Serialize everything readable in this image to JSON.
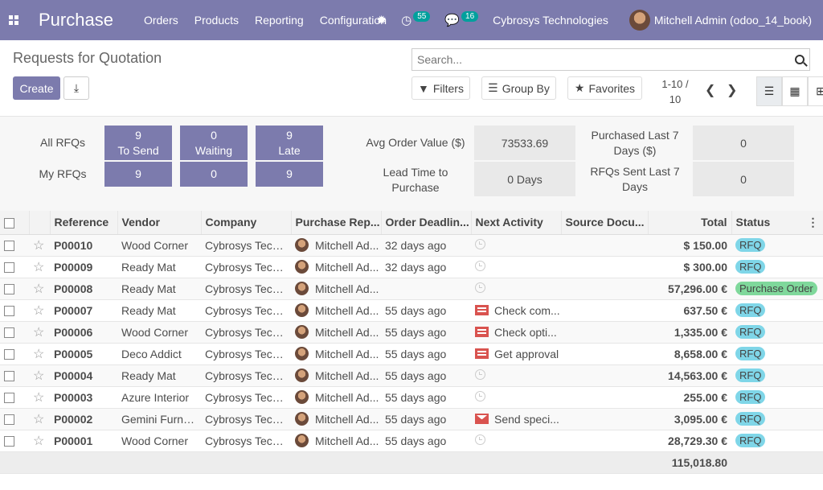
{
  "navbar": {
    "brand": "Purchase",
    "menu": [
      "Orders",
      "Products",
      "Reporting",
      "Configuration"
    ],
    "activity_count": "55",
    "message_count": "16",
    "company": "Cybrosys Technologies",
    "user": "Mitchell Admin (odoo_14_book)",
    "bg_color": "#7c7bad"
  },
  "control": {
    "breadcrumb": "Requests for Quotation",
    "create_label": "Create",
    "search_placeholder": "Search...",
    "filters_label": "Filters",
    "groupby_label": "Group By",
    "favorites_label": "Favorites",
    "pager_range": "1-10 /",
    "pager_total": "10"
  },
  "dashboard": {
    "all_rfqs_label": "All RFQs",
    "my_rfqs_label": "My RFQs",
    "to_send_count": "9",
    "to_send_label": "To Send",
    "waiting_count": "0",
    "waiting_label": "Waiting",
    "late_count": "9",
    "late_label": "Late",
    "my_to_send": "9",
    "my_waiting": "0",
    "my_late": "9",
    "avg_order_label": "Avg Order Value ($)",
    "avg_order_value": "73533.69",
    "lead_time_label": "Lead Time to Purchase",
    "lead_time_value": "0  Days",
    "purchased_label": "Purchased Last 7 Days ($)",
    "purchased_value": "0",
    "rfq_sent_label": "RFQs Sent Last 7 Days",
    "rfq_sent_value": "0"
  },
  "table": {
    "headers": [
      "Reference",
      "Vendor",
      "Company",
      "Purchase Rep...",
      "Order Deadlin...",
      "Next Activity",
      "Source Docu...",
      "Total",
      "Status"
    ],
    "rows": [
      {
        "ref": "P00010",
        "vendor": "Wood Corner",
        "company": "Cybrosys Tech...",
        "rep": "Mitchell Ad...",
        "deadline": "32 days ago",
        "activity": "",
        "activity_icon": "clock",
        "total": "$ 150.00",
        "status": "RFQ",
        "status_color": "#7fd6e8"
      },
      {
        "ref": "P00009",
        "vendor": "Ready Mat",
        "company": "Cybrosys Tech...",
        "rep": "Mitchell Ad...",
        "deadline": "32 days ago",
        "activity": "",
        "activity_icon": "clock",
        "total": "$ 300.00",
        "status": "RFQ",
        "status_color": "#7fd6e8"
      },
      {
        "ref": "P00008",
        "vendor": "Ready Mat",
        "company": "Cybrosys Tech...",
        "rep": "Mitchell Ad...",
        "deadline": "",
        "activity": "",
        "activity_icon": "clock",
        "total": "57,296.00 €",
        "status": "Purchase Order",
        "status_color": "#7fd89b"
      },
      {
        "ref": "P00007",
        "vendor": "Ready Mat",
        "company": "Cybrosys Tech...",
        "rep": "Mitchell Ad...",
        "deadline": "55 days ago",
        "activity": "Check com...",
        "activity_icon": "todo",
        "total": "637.50 €",
        "status": "RFQ",
        "status_color": "#7fd6e8"
      },
      {
        "ref": "P00006",
        "vendor": "Wood Corner",
        "company": "Cybrosys Tech...",
        "rep": "Mitchell Ad...",
        "deadline": "55 days ago",
        "activity": "Check opti...",
        "activity_icon": "todo",
        "total": "1,335.00 €",
        "status": "RFQ",
        "status_color": "#7fd6e8"
      },
      {
        "ref": "P00005",
        "vendor": "Deco Addict",
        "company": "Cybrosys Tech...",
        "rep": "Mitchell Ad...",
        "deadline": "55 days ago",
        "activity": "Get approval",
        "activity_icon": "todo",
        "total": "8,658.00 €",
        "status": "RFQ",
        "status_color": "#7fd6e8"
      },
      {
        "ref": "P00004",
        "vendor": "Ready Mat",
        "company": "Cybrosys Tech...",
        "rep": "Mitchell Ad...",
        "deadline": "55 days ago",
        "activity": "",
        "activity_icon": "clock",
        "total": "14,563.00 €",
        "status": "RFQ",
        "status_color": "#7fd6e8"
      },
      {
        "ref": "P00003",
        "vendor": "Azure Interior",
        "company": "Cybrosys Tech...",
        "rep": "Mitchell Ad...",
        "deadline": "55 days ago",
        "activity": "",
        "activity_icon": "clock",
        "total": "255.00 €",
        "status": "RFQ",
        "status_color": "#7fd6e8"
      },
      {
        "ref": "P00002",
        "vendor": "Gemini Furniture",
        "company": "Cybrosys Tech...",
        "rep": "Mitchell Ad...",
        "deadline": "55 days ago",
        "activity": "Send speci...",
        "activity_icon": "mail",
        "total": "3,095.00 €",
        "status": "RFQ",
        "status_color": "#7fd6e8"
      },
      {
        "ref": "P00001",
        "vendor": "Wood Corner",
        "company": "Cybrosys Tech...",
        "rep": "Mitchell Ad...",
        "deadline": "55 days ago",
        "activity": "",
        "activity_icon": "clock",
        "total": "28,729.30 €",
        "status": "RFQ",
        "status_color": "#7fd6e8"
      }
    ],
    "footer_total": "115,018.80"
  }
}
